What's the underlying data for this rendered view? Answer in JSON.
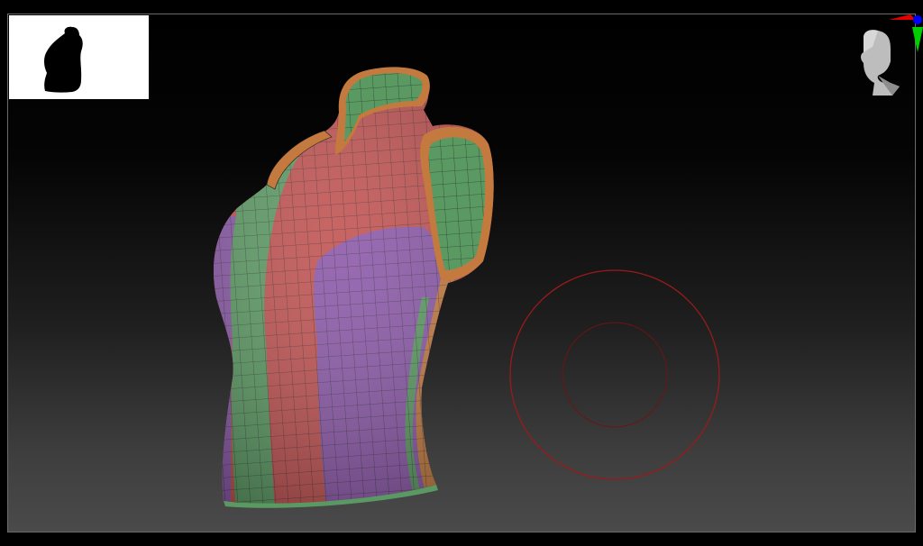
{
  "viewport": {
    "background_top": "#000000",
    "background_bottom": "#4a4a4a",
    "frame_color": "#6a6a6a"
  },
  "navigator": {
    "background": "#ffffff",
    "silhouette_color": "#000000",
    "icon": "model-silhouette-icon"
  },
  "model": {
    "polygroup_colors": {
      "red": "#c0504f",
      "green": "#5a9a62",
      "purple": "#8a56a8",
      "orange": "#c47a3e"
    },
    "wireframe_color": "#1c1c1c"
  },
  "brush_cursor": {
    "color": "#9a1a1a",
    "icon": "brush-radius-icon"
  },
  "orientation_gizmo": {
    "icon": "head-orientation-icon",
    "x_axis_color": "#e00000",
    "y_axis_color": "#00d000",
    "z_axis_color": "#0000ff"
  }
}
